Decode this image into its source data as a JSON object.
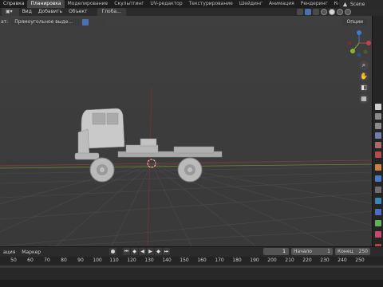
{
  "menubar": {
    "items": [
      "Справка"
    ],
    "workspaces": [
      "Планировка",
      "Моделирование",
      "Скульптинг",
      "UV-редактор",
      "Текстурирование",
      "Шейдинг",
      "Анимация",
      "Рендеринг",
      "Композитинг",
      "На"
    ],
    "active_workspace": "Планировка",
    "scene_name": "Scene"
  },
  "viewport_header": {
    "items": [
      "Вид",
      "Добавить",
      "Объект"
    ],
    "mode_prefix": "ат:",
    "orientation": "Глоба..."
  },
  "tool_settings": {
    "select_tool": "Прямоугольное выде...",
    "options_label": "Опции"
  },
  "timeline": {
    "menus": [
      "ация",
      "Маркер"
    ],
    "current_frame": "1",
    "start_label": "Начало",
    "start_value": "1",
    "end_label": "Конец",
    "end_value": "250",
    "ticks": [
      "50",
      "60",
      "70",
      "80",
      "90",
      "100",
      "110",
      "120",
      "130",
      "140",
      "150",
      "160",
      "170",
      "180",
      "190",
      "200",
      "210",
      "220",
      "230",
      "240",
      "250"
    ]
  },
  "colors": {
    "accent_blue": "#4a72b0",
    "x_axis": "#c0444b",
    "y_axis": "#8ab333",
    "z_axis": "#3d7ccf"
  },
  "icons": [
    "scene-icon",
    "zoom-icon",
    "hand-pan-icon",
    "camera-icon",
    "grid-view-icon",
    "record-icon",
    "jump-start-icon",
    "prev-keyframe-icon",
    "play-reverse-icon",
    "play-icon",
    "next-keyframe-icon",
    "jump-end-icon"
  ]
}
